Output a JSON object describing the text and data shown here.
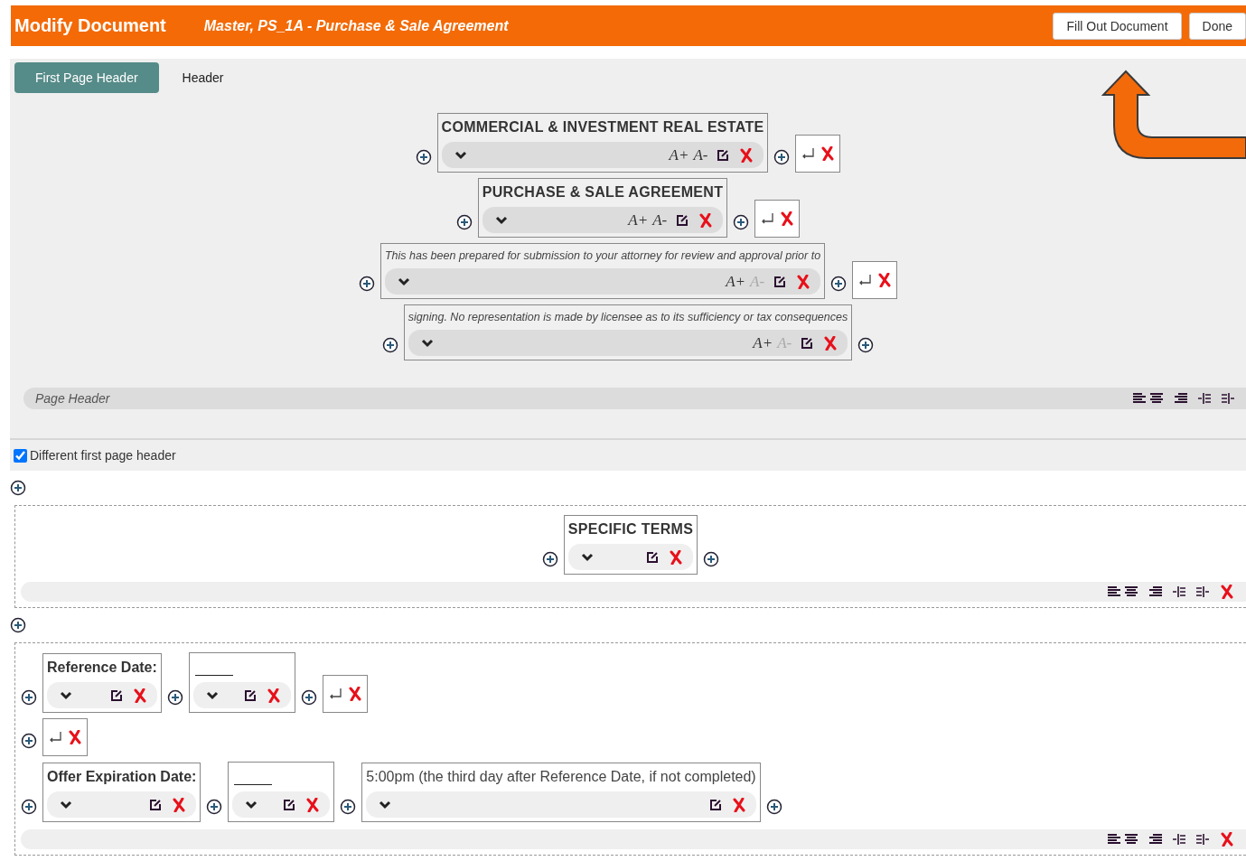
{
  "header": {
    "title": "Modify Document",
    "subtitle": "Master, PS_1A - Purchase & Sale Agreement",
    "buttons": [
      "Fill Out Document",
      "Done"
    ]
  },
  "tabs": [
    {
      "label": "First Page Header",
      "selected": true
    },
    {
      "label": "Header",
      "selected": false
    }
  ],
  "header_rows": [
    {
      "blocks": [
        {
          "text": "COMMERCIAL & INVESTMENT REAL ESTATE",
          "kind": "heading",
          "grow": {
            "label": "A+",
            "disabled": false
          },
          "shrink": {
            "label": "A-",
            "disabled": false
          }
        }
      ],
      "line_break": true
    },
    {
      "blocks": [
        {
          "text": "PURCHASE & SALE AGREEMENT",
          "kind": "heading",
          "grow": {
            "label": "A+",
            "disabled": false
          },
          "shrink": {
            "label": "A-",
            "disabled": false
          }
        }
      ],
      "line_break": true
    },
    {
      "blocks": [
        {
          "text": "This has been prepared for submission to your attorney for review and approval prior to",
          "kind": "italic",
          "grow": {
            "label": "A+",
            "disabled": false
          },
          "shrink": {
            "label": "A-",
            "disabled": true
          }
        }
      ],
      "line_break": true
    },
    {
      "blocks": [
        {
          "text": "signing. No representation is made by licensee as to its sufficiency or tax consequences",
          "kind": "italic",
          "grow": {
            "label": "A+",
            "disabled": false
          },
          "shrink": {
            "label": "A-",
            "disabled": true
          }
        }
      ],
      "line_break": false
    }
  ],
  "page_header_bar": {
    "placeholder": "Page Header",
    "deletable": false
  },
  "different_first_page": {
    "label": "Different first page header",
    "checked": true
  },
  "sections": [
    {
      "kind": "centered",
      "rows": [
        {
          "blocks": [
            {
              "text": "SPECIFIC TERMS",
              "kind": "heading"
            }
          ],
          "line_break": false
        }
      ],
      "deletable": true
    },
    {
      "kind": "flow",
      "rows": [
        {
          "blocks": [
            {
              "text": "Reference Date:",
              "kind": "bold"
            },
            {
              "kind": "blank"
            }
          ],
          "line_break": true
        },
        {
          "blocks": [],
          "line_break": true
        },
        {
          "blocks": [
            {
              "text": "Offer Expiration Date:",
              "kind": "bold"
            },
            {
              "kind": "blank"
            },
            {
              "text": "5:00pm (the third day after Reference Date, if not completed)",
              "kind": "plain"
            }
          ],
          "line_break": false
        }
      ],
      "deletable": true
    }
  ]
}
